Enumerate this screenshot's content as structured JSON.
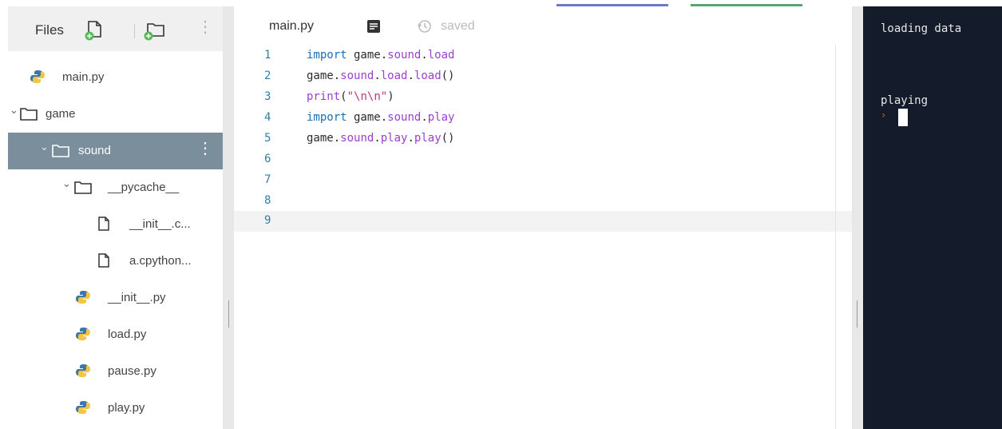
{
  "sidebar": {
    "title": "Files",
    "tree": [
      {
        "label": "main.py",
        "type": "python"
      },
      {
        "label": "game",
        "type": "folder"
      },
      {
        "label": "sound",
        "type": "folder"
      },
      {
        "label": "__pycache__",
        "type": "folder"
      },
      {
        "label": "__init__.c...",
        "type": "file"
      },
      {
        "label": "a.cpython...",
        "type": "file"
      },
      {
        "label": "__init__.py",
        "type": "python"
      },
      {
        "label": "load.py",
        "type": "python"
      },
      {
        "label": "pause.py",
        "type": "python"
      },
      {
        "label": "play.py",
        "type": "python"
      }
    ]
  },
  "editor": {
    "tab_label": "main.py",
    "saved_label": "saved",
    "line_numbers": [
      "1",
      "2",
      "3",
      "4",
      "5",
      "6",
      "7",
      "8",
      "9"
    ]
  },
  "console": {
    "lines": [
      "loading data",
      "playing"
    ]
  },
  "colors": {
    "selected_bg": "#7b8e9c",
    "console_bg": "#141c2c",
    "prompt": "#e5572b",
    "accent_blue": "#6c7bbf",
    "accent_green": "#5aa56a"
  }
}
